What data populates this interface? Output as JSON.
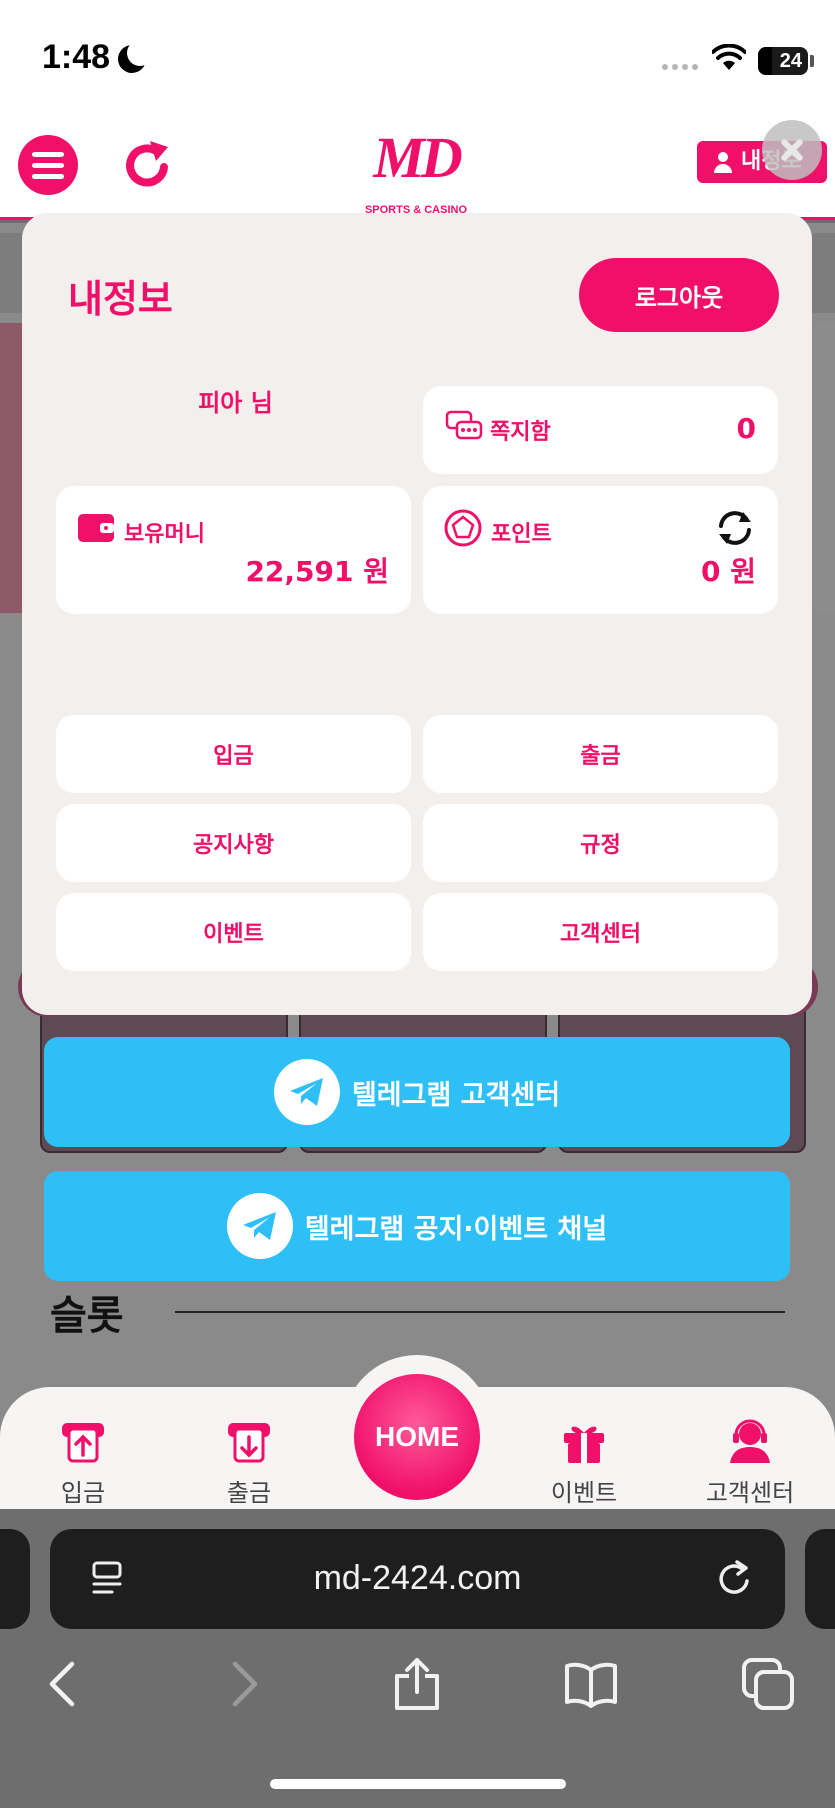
{
  "status_bar": {
    "time": "1:48",
    "battery": "24"
  },
  "header": {
    "logo_text": "MD",
    "logo_subtitle": "SPORTS & CASINO",
    "my_info_label": "내정보"
  },
  "modal": {
    "title": "내정보",
    "logout_label": "로그아웃",
    "user_name": "피아 님",
    "messages": {
      "label": "쪽지함",
      "value": "0"
    },
    "money": {
      "label": "보유머니",
      "value": "22,591 원"
    },
    "points": {
      "label": "포인트",
      "value": "0 원"
    },
    "menu": [
      "입금",
      "출금",
      "공지사항",
      "규정",
      "이벤트",
      "고객센터"
    ]
  },
  "telegram": {
    "support_label": "텔레그램 고객센터",
    "channel_label": "텔레그램 공지·이벤트 채널"
  },
  "section": {
    "slot_title": "슬롯"
  },
  "bottom_nav": {
    "deposit": "입금",
    "withdraw": "출금",
    "home": "HOME",
    "event": "이벤트",
    "support": "고객센터"
  },
  "browser": {
    "url": "md-2424.com"
  },
  "colors": {
    "brand": "#f0106a",
    "telegram": "#2ebff7",
    "modal_bg": "#f2efec"
  }
}
